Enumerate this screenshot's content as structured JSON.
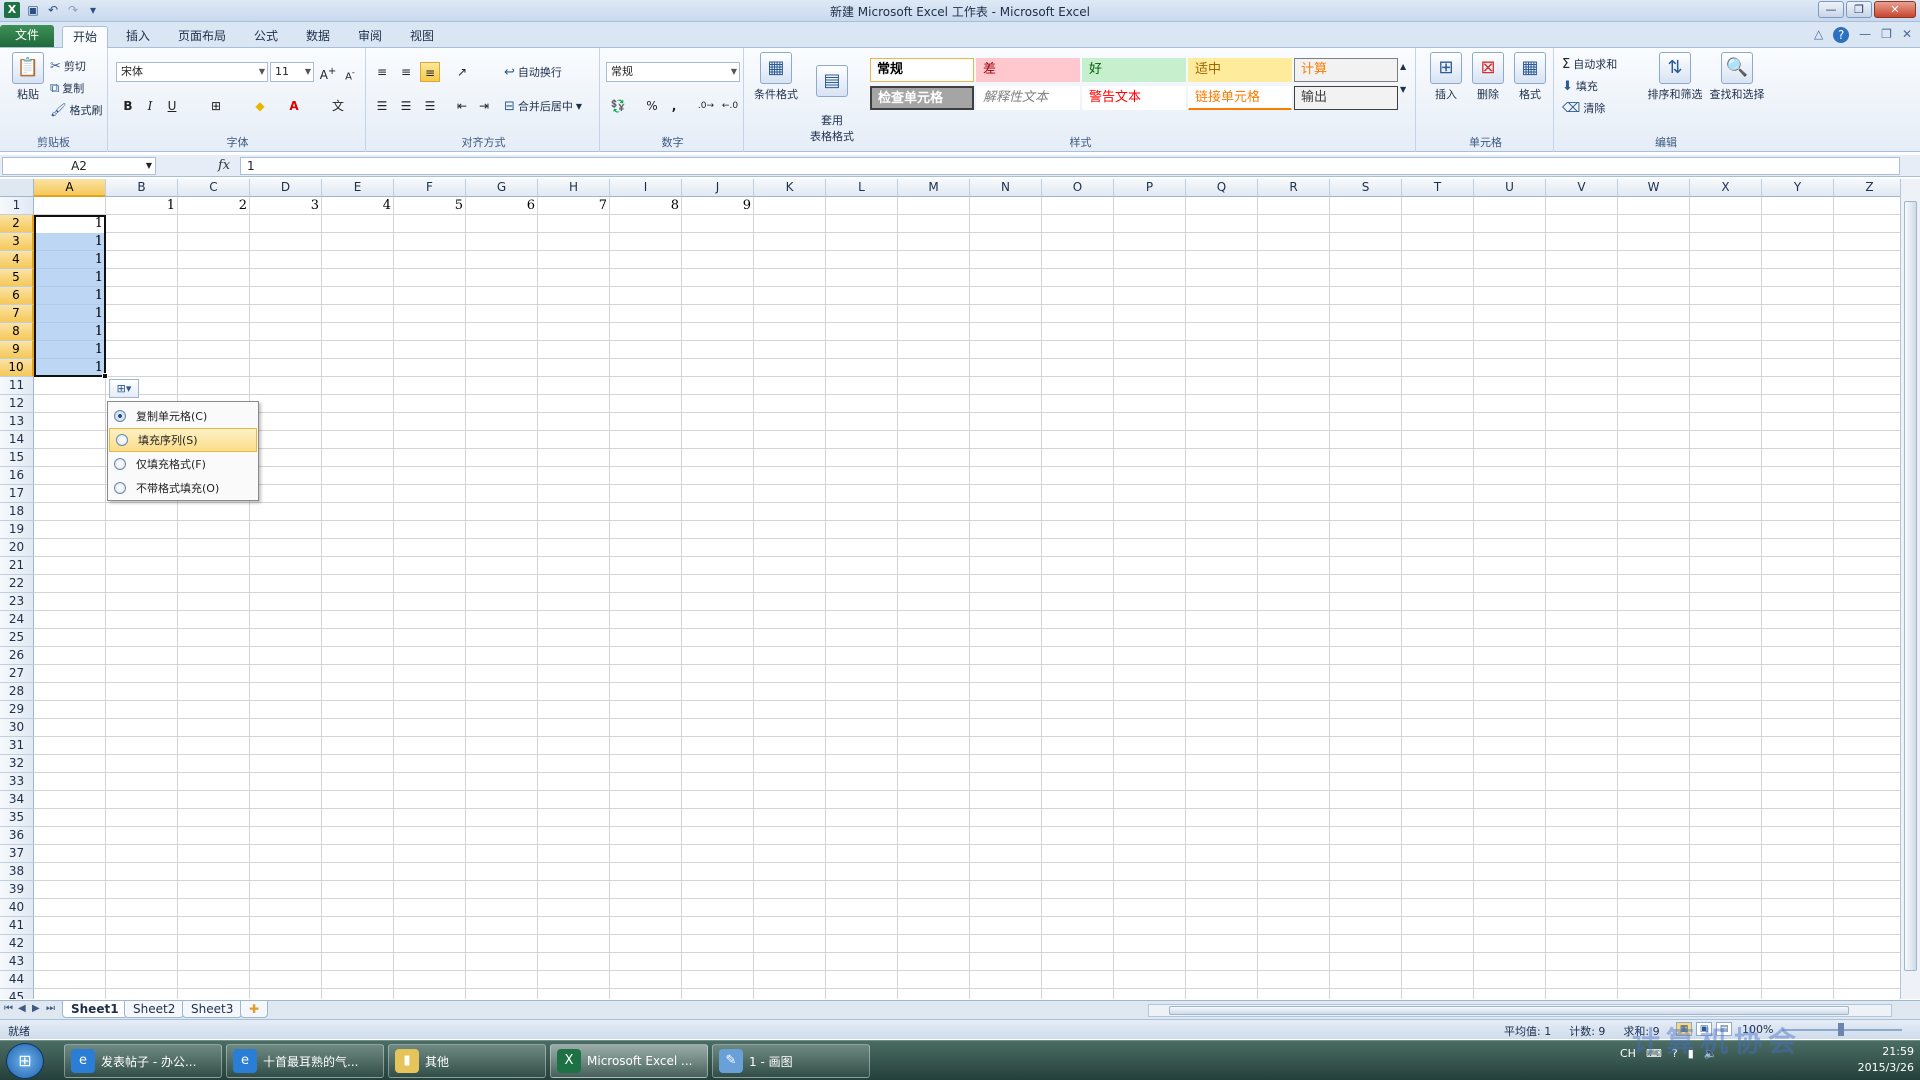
{
  "window": {
    "title": "新建 Microsoft Excel 工作表 - Microsoft Excel"
  },
  "ribbon_tabs": [
    "文件",
    "开始",
    "插入",
    "页面布局",
    "公式",
    "数据",
    "审阅",
    "视图"
  ],
  "clipboard": {
    "paste": "粘贴",
    "cut": "剪切",
    "copy": "复制",
    "format_painter": "格式刷",
    "group": "剪贴板"
  },
  "font": {
    "name": "宋体",
    "size": "11",
    "bold": "B",
    "italic": "I",
    "underline": "U",
    "group": "字体"
  },
  "alignment": {
    "wrap": "自动换行",
    "merge": "合并后居中",
    "group": "对齐方式"
  },
  "number": {
    "format": "常规",
    "percent": "%",
    "comma": ",",
    "group": "数字"
  },
  "styles": {
    "conditional": "条件格式",
    "table_format": "套用\n表格格式",
    "items": [
      {
        "label": "常规",
        "bg": "#ffffff",
        "fg": "#000000",
        "border": "#f0b44a"
      },
      {
        "label": "差",
        "bg": "#ffc7ce",
        "fg": "#9c0006",
        "border": "#ffc7ce"
      },
      {
        "label": "好",
        "bg": "#c6efce",
        "fg": "#006100",
        "border": "#c6efce"
      },
      {
        "label": "适中",
        "bg": "#ffeb9c",
        "fg": "#9c6500",
        "border": "#ffeb9c"
      },
      {
        "label": "计算",
        "bg": "#f2f2f2",
        "fg": "#fa7d00",
        "border": "#7f7f7f"
      },
      {
        "label": "检查单元格",
        "bg": "#a5a5a5",
        "fg": "#ffffff",
        "border": "#3f3f3f"
      },
      {
        "label": "解释性文本",
        "bg": "#ffffff",
        "fg": "#7f7f7f",
        "border": "#ffffff"
      },
      {
        "label": "警告文本",
        "bg": "#ffffff",
        "fg": "#ff0000",
        "border": "#ffffff"
      },
      {
        "label": "链接单元格",
        "bg": "#ffffff",
        "fg": "#fa7d00",
        "border": "#ffffff"
      },
      {
        "label": "输出",
        "bg": "#f2f2f2",
        "fg": "#3f3f3f",
        "border": "#3f3f3f"
      }
    ],
    "group": "样式"
  },
  "cells_group": {
    "insert": "插入",
    "delete": "删除",
    "format": "格式",
    "group": "单元格"
  },
  "editing": {
    "autosum": "自动求和",
    "fill": "填充",
    "clear": "清除",
    "sort_filter": "排序和筛选",
    "find_select": "查找和选择",
    "group": "编辑"
  },
  "formula_bar": {
    "name_box": "A2",
    "fx": "fx",
    "value": "1"
  },
  "columns": [
    "A",
    "B",
    "C",
    "D",
    "E",
    "F",
    "G",
    "H",
    "I",
    "J",
    "K",
    "L",
    "M",
    "N",
    "O",
    "P",
    "Q",
    "R",
    "S",
    "T",
    "U",
    "V",
    "W",
    "X",
    "Y",
    "Z"
  ],
  "row1_values": [
    "",
    "1",
    "2",
    "3",
    "4",
    "5",
    "6",
    "7",
    "8",
    "9"
  ],
  "colA_values": [
    "1",
    "1",
    "1",
    "1",
    "1",
    "1",
    "1",
    "1",
    "1"
  ],
  "autofill_menu": {
    "items": [
      {
        "label": "复制单元格(C)",
        "checked": true
      },
      {
        "label": "填充序列(S)",
        "checked": false,
        "highlighted": true
      },
      {
        "label": "仅填充格式(F)",
        "checked": false
      },
      {
        "label": "不带格式填充(O)",
        "checked": false
      }
    ]
  },
  "sheets": [
    "Sheet1",
    "Sheet2",
    "Sheet3"
  ],
  "status": {
    "ready": "就绪",
    "average": "平均值: 1",
    "count": "计数: 9",
    "sum": "求和: 9",
    "zoom": "100%"
  },
  "taskbar": {
    "items": [
      {
        "label": "发表帖子 - 办公...",
        "icon": "ie-icon"
      },
      {
        "label": "十首最耳熟的气...",
        "icon": "ie-icon"
      },
      {
        "label": "其他",
        "icon": "folder-icon"
      },
      {
        "label": "Microsoft Excel ...",
        "icon": "excel-icon",
        "active": true
      },
      {
        "label": "1 - 画图",
        "icon": "paint-icon"
      }
    ],
    "lang": "CH",
    "time": "21:59",
    "date": "2015/3/26"
  },
  "watermark": "计算机协会"
}
